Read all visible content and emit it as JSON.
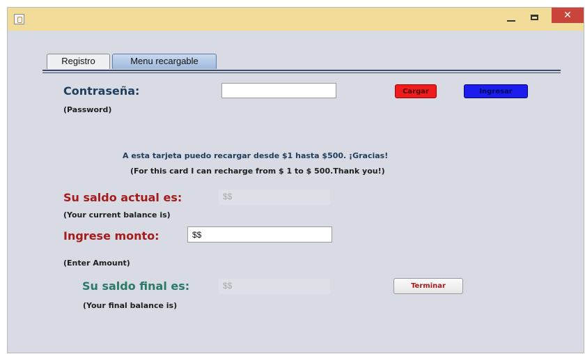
{
  "window": {
    "close_symbol": "✕"
  },
  "tabs": [
    {
      "label": "Registro"
    },
    {
      "label": "Menu recargable"
    }
  ],
  "password": {
    "label": "Contraseña:",
    "sublabel": "(Password)",
    "value": ""
  },
  "buttons": {
    "cargar": "Cargar",
    "ingresar": "Ingresar",
    "terminar": "Terminar"
  },
  "info": {
    "line_es": "A esta tarjeta puedo recargar desde $1 hasta $500. ¡Gracias!",
    "line_en": "(For this card I can recharge from $ 1 to $ 500.Thank you!)"
  },
  "current_balance": {
    "label": "Su saldo actual es:",
    "value": "$$",
    "sublabel": "(Your current balance is)"
  },
  "amount": {
    "label": "Ingrese monto:",
    "value": "$$",
    "sublabel": "(Enter Amount)"
  },
  "final_balance": {
    "label": "Su saldo final es:",
    "value": "$$",
    "sublabel": "(Your final balance is)"
  },
  "colors": {
    "titlebar": "#f2dc9a",
    "close_button": "#c9453c",
    "cargar_button": "#ee1c1c",
    "ingresar_button": "#1c1ced",
    "password_label": "#1f3d5c",
    "current_balance_label": "#a61b1b",
    "amount_label": "#a61b1b",
    "final_balance_label": "#2a7a66",
    "info_text": "#1f3d5c",
    "terminar_text": "#a61b1b"
  },
  "icons": {
    "app": "java-cup-icon",
    "minimize": "minimize-icon",
    "maximize": "maximize-icon",
    "close": "close-icon"
  }
}
